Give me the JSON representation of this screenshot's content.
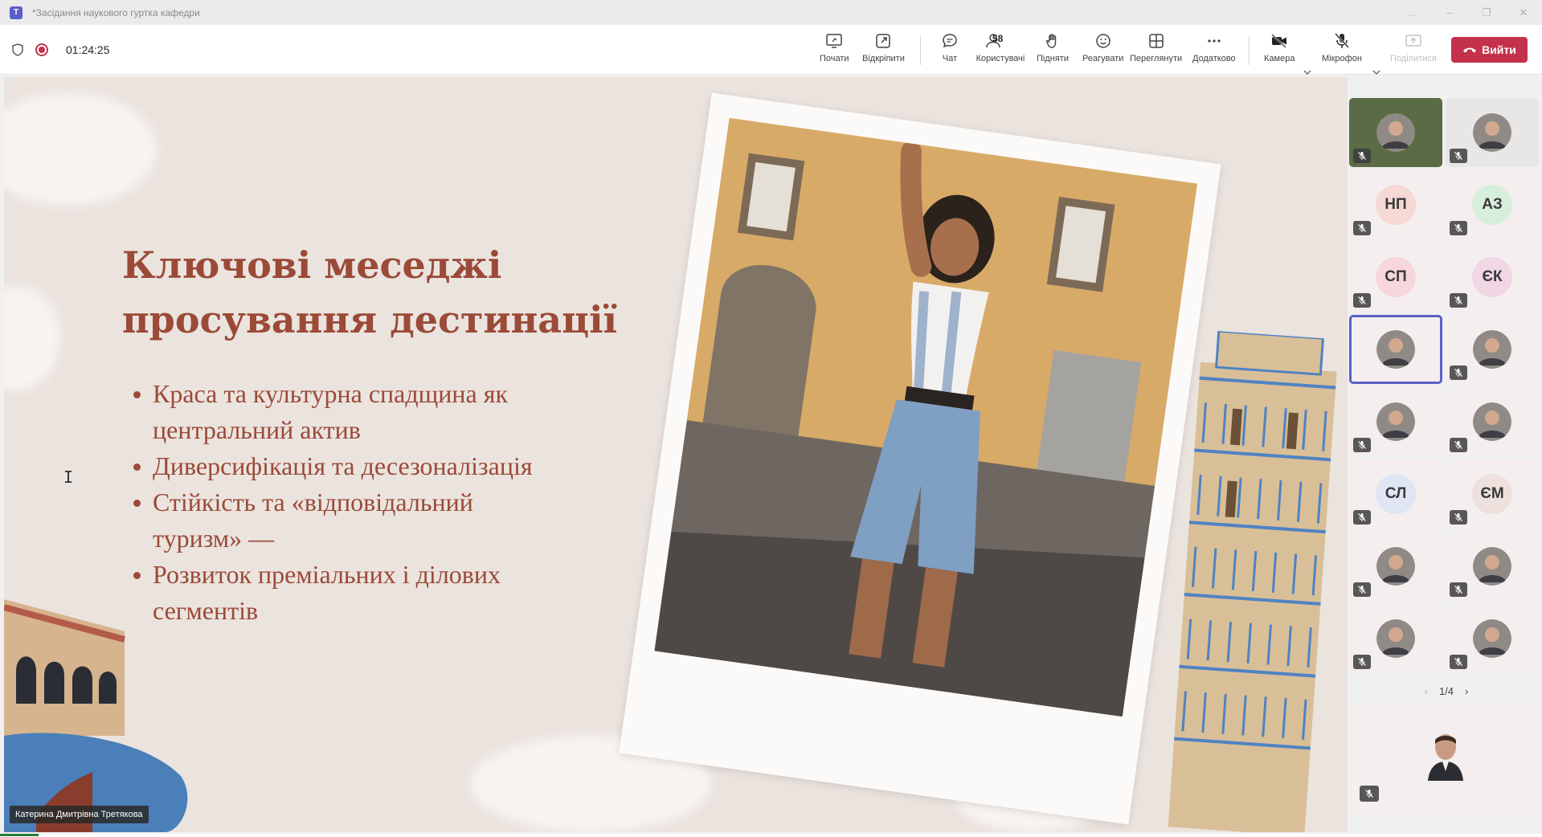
{
  "window": {
    "title": "*Засідання наукового гуртка кафедри",
    "controls": [
      "…",
      "–",
      "❐",
      "✕"
    ]
  },
  "call": {
    "timer": "01:24:25"
  },
  "toolbar": {
    "record_label": "Почати",
    "popout_label": "Відкріпити",
    "chat_label": "Чат",
    "people_label": "Користувачі",
    "people_count": "58",
    "raise_label": "Підняти",
    "react_label": "Реагувати",
    "view_label": "Переглянути",
    "more_label": "Додатково",
    "camera_label": "Камера",
    "mic_label": "Мікрофон",
    "share_label": "Поділитися",
    "leave_label": "Вийти"
  },
  "slide": {
    "title_line1": "Ключові меседжі",
    "title_line2": "просування дестинації",
    "bullets": [
      [
        "Краса та культурна спадщина як",
        "центральний актив"
      ],
      [
        "Диверсифікація та десезоналізація"
      ],
      [
        "Стійкість та «відповідальний",
        "туризм» —"
      ],
      [
        "Розвиток преміальних і ділових",
        "сегментів"
      ]
    ]
  },
  "presenter": {
    "name": "Катерина Дмитрівна Третякова"
  },
  "participants": [
    {
      "type": "photo",
      "initials": "",
      "muted": true,
      "bg": "#5a6b45"
    },
    {
      "type": "photo",
      "initials": "",
      "muted": true,
      "bg": "#e9e6e6"
    },
    {
      "type": "initials",
      "initials": "НП",
      "muted": true,
      "avatar_bg": "#f6d8d4"
    },
    {
      "type": "initials",
      "initials": "АЗ",
      "muted": true,
      "avatar_bg": "#d7eedd"
    },
    {
      "type": "initials",
      "initials": "СП",
      "muted": true,
      "avatar_bg": "#f7d6dc"
    },
    {
      "type": "initials",
      "initials": "ЄК",
      "muted": true,
      "avatar_bg": "#f1d6e4"
    },
    {
      "type": "photo",
      "initials": "",
      "muted": false,
      "active": true,
      "bg": "#f4efee"
    },
    {
      "type": "photo",
      "initials": "",
      "muted": true,
      "bg": "#f4efee"
    },
    {
      "type": "photo",
      "initials": "",
      "muted": true,
      "bg": "#f4efee"
    },
    {
      "type": "photo",
      "initials": "",
      "muted": true,
      "bg": "#f4efee"
    },
    {
      "type": "initials",
      "initials": "СЛ",
      "muted": true,
      "avatar_bg": "#dfe5f2"
    },
    {
      "type": "initials",
      "initials": "ЄМ",
      "muted": true,
      "avatar_bg": "#eee0dd"
    },
    {
      "type": "photo",
      "initials": "",
      "muted": true,
      "bg": "#f4efee"
    },
    {
      "type": "photo",
      "initials": "",
      "muted": true,
      "bg": "#f4efee"
    },
    {
      "type": "photo",
      "initials": "",
      "muted": true,
      "bg": "#f4efee"
    },
    {
      "type": "photo",
      "initials": "",
      "muted": true,
      "bg": "#f4efee"
    }
  ],
  "pager": {
    "text": "1/4"
  },
  "colors": {
    "accent": "#5b5fc7",
    "leave": "#c4314b",
    "slide_text": "#9b4a38",
    "slide_bg": "#ebe3de"
  },
  "icons": [
    "teams-icon",
    "shield-icon",
    "record-icon",
    "popout-icon",
    "chat-icon",
    "people-icon",
    "hand-icon",
    "smile-icon",
    "grid-icon",
    "more-icon",
    "camera-off-icon",
    "mic-off-icon",
    "share-icon",
    "phone-icon"
  ]
}
